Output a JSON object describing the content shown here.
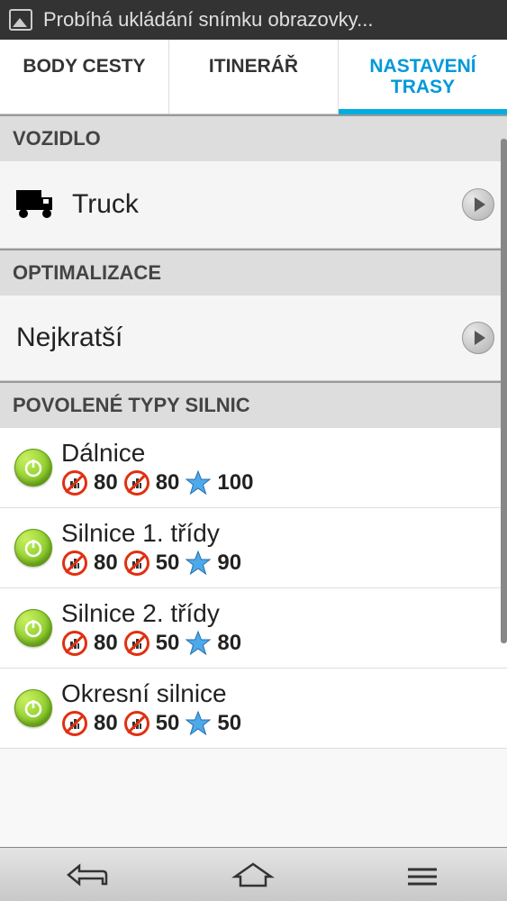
{
  "status_bar": {
    "text": "Probíhá ukládání snímku obrazovky..."
  },
  "tabs": [
    {
      "label": "BODY CESTY",
      "active": false
    },
    {
      "label": "ITINERÁŘ",
      "active": false
    },
    {
      "label": "NASTAVENÍ TRASY",
      "active": true
    }
  ],
  "sections": {
    "vehicle": {
      "header": "VOZIDLO",
      "value": "Truck"
    },
    "optimization": {
      "header": "OPTIMALIZACE",
      "value": "Nejkratší"
    },
    "roadtypes": {
      "header": "POVOLENÉ TYPY SILNIC",
      "items": [
        {
          "name": "Dálnice",
          "v1": "80",
          "v2": "80",
          "star": "100"
        },
        {
          "name": "Silnice 1. třídy",
          "v1": "80",
          "v2": "50",
          "star": "90"
        },
        {
          "name": "Silnice 2. třídy",
          "v1": "80",
          "v2": "50",
          "star": "80"
        },
        {
          "name": "Okresní silnice",
          "v1": "80",
          "v2": "50",
          "star": "50"
        }
      ]
    }
  }
}
